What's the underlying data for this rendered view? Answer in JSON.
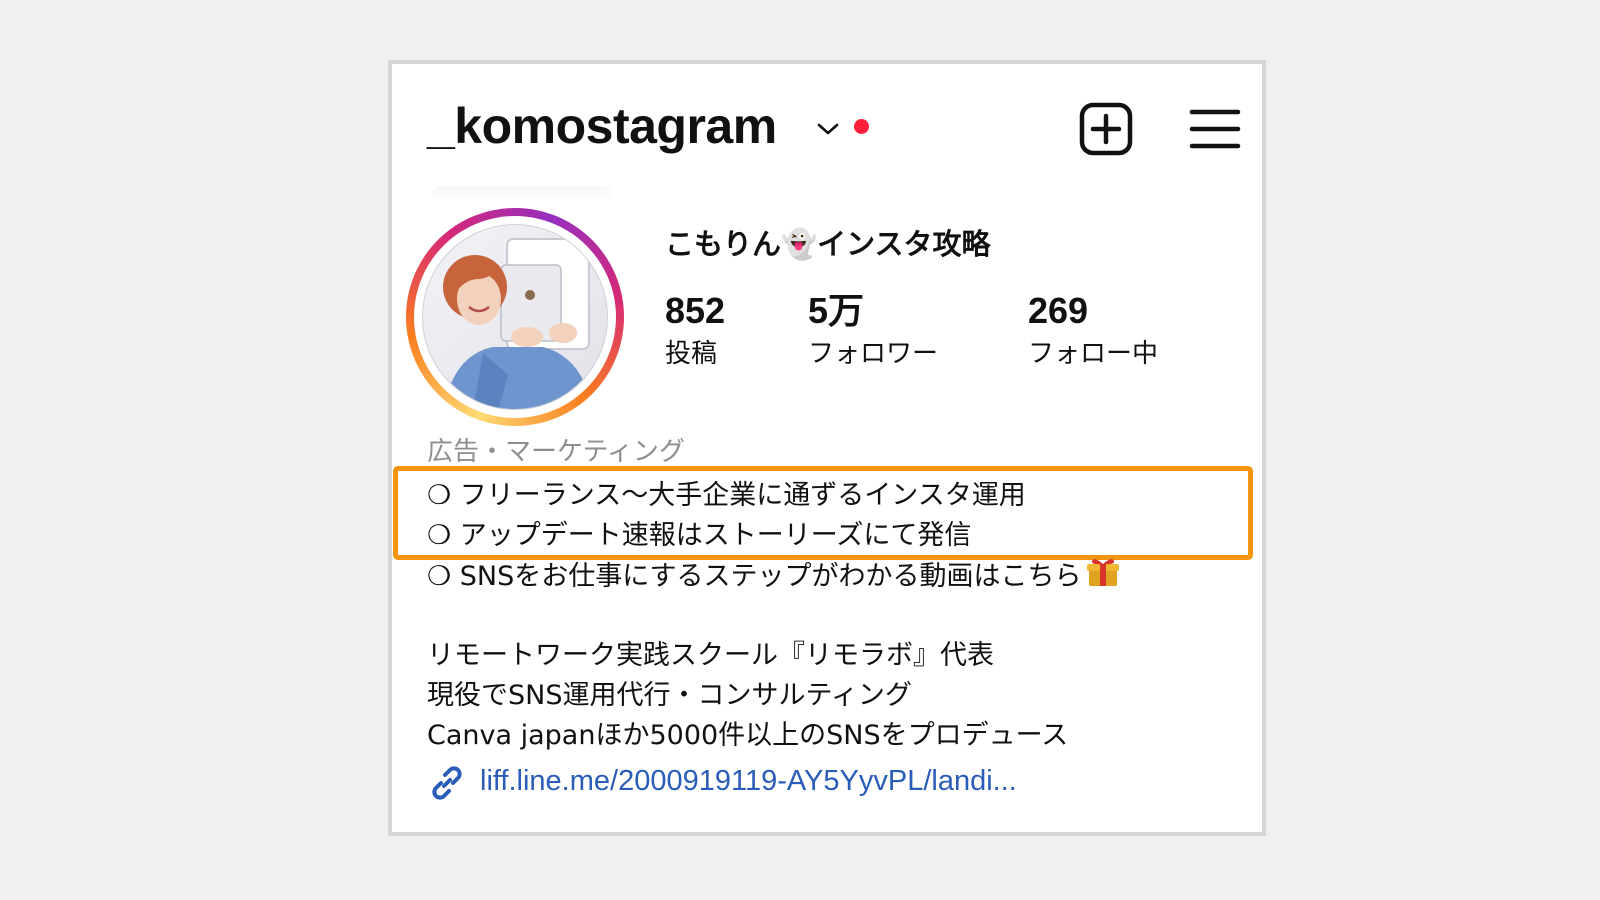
{
  "header": {
    "username": "_komostagram"
  },
  "profile": {
    "display_name": "こもりん👻インスタ攻略",
    "stats": {
      "posts_count": "852",
      "posts_label": "投稿",
      "followers_count": "5万",
      "followers_label": "フォロワー",
      "following_count": "269",
      "following_label": "フォロー中"
    },
    "category": "広告・マーケティング",
    "bio_lines": [
      "❍ フリーランス〜大手企業に通ずるインスタ運用",
      "❍ アップデート速報はストーリーズにて発信",
      "❍ SNSをお仕事にするステップがわかる動画はこちら",
      "リモートワーク実践スクール『リモラボ』代表",
      "現役でSNS運用代行・コンサルティング",
      "Canva japanほか5000件以上のSNSをプロデュース"
    ],
    "link": "liff.line.me/2000919119-AY5YyvPL/landi..."
  },
  "colors": {
    "highlight_border": "#f5940f",
    "link": "#2a5db8",
    "notification_dot": "#ff1f3c"
  },
  "icons": {
    "dropdown": "chevron-down-icon",
    "create": "plus-square-icon",
    "menu": "hamburger-menu-icon",
    "link": "link-icon",
    "gift": "gift-emoji-icon"
  }
}
